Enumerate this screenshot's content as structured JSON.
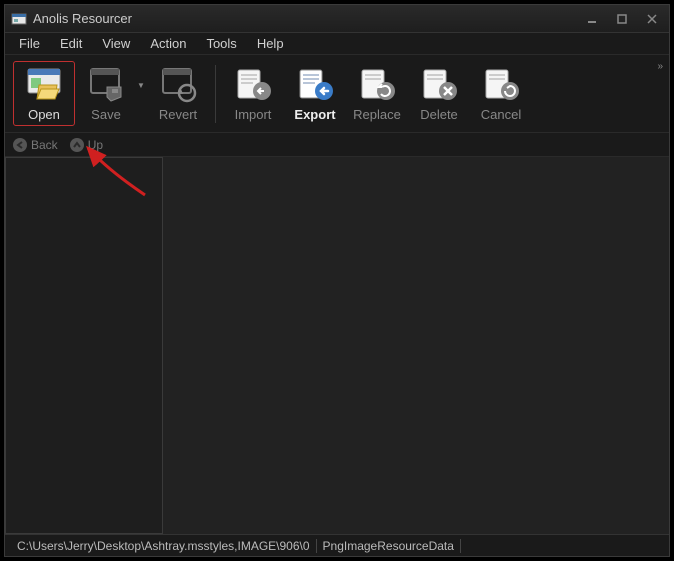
{
  "window": {
    "title": "Anolis Resourcer"
  },
  "menu": {
    "items": [
      "File",
      "Edit",
      "View",
      "Action",
      "Tools",
      "Help"
    ]
  },
  "toolbar": {
    "open": "Open",
    "save": "Save",
    "revert": "Revert",
    "import": "Import",
    "export": "Export",
    "replace": "Replace",
    "delete": "Delete",
    "cancel": "Cancel"
  },
  "nav": {
    "back": "Back",
    "up": "Up"
  },
  "status": {
    "path": "C:\\Users\\Jerry\\Desktop\\Ashtray.msstyles,IMAGE\\906\\0",
    "type": "PngImageResourceData"
  },
  "annotation": {
    "arrow_color": "#d02020"
  }
}
